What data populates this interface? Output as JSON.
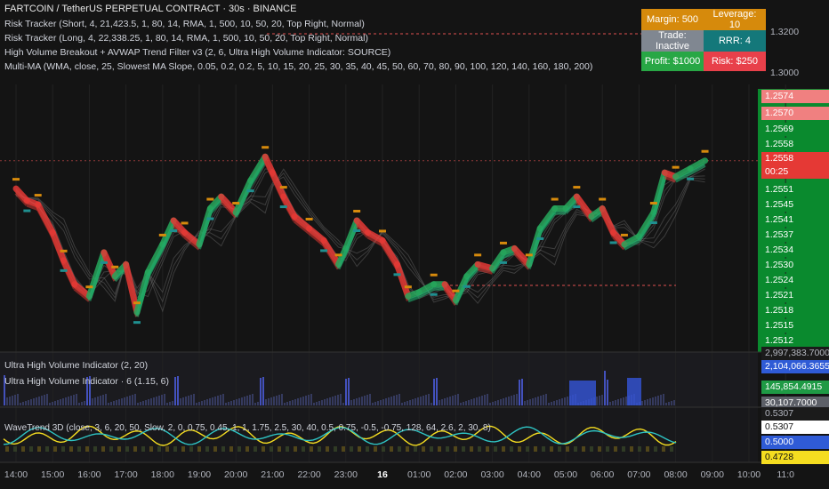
{
  "symbol_title": "FARTCOIN / TetherUS PERPETUAL CONTRACT · 30s · BINANCE",
  "indicators": [
    "Risk Tracker (Short, 4, 21,423.5, 1, 80, 14, RMA, 1, 500, 10, 50, 20, Top Right, Normal)",
    "Risk Tracker (Long, 4, 22,338.25, 1, 80, 14, RMA, 1, 500, 10, 50, 20, Top Right, Normal)",
    "High Volume Breakout + AVWAP Trend Filter v3 (2, 6, Ultra High Volume Indicator: SOURCE)",
    "Multi-MA (WMA, close, 25, Slowest MA Slope, 0.05, 0.2, 0.2, 5, 10, 15, 20, 25, 30, 35, 40, 45, 50, 60, 70, 80, 90, 100, 120, 140, 160, 180, 200)"
  ],
  "risk_table": {
    "margin": "Margin: 500",
    "leverage": "Leverage: 10",
    "trade": "Trade: Inactive",
    "rrr": "RRR: 4",
    "profit": "Profit: $1000",
    "risk": "Risk: $250"
  },
  "price_axis": {
    "ticks_upper": [
      "1.3200",
      "1.3000"
    ],
    "ticks": [
      "1.2569",
      "1.2558",
      "1.2551",
      "1.2545",
      "1.2541",
      "1.2537",
      "1.2534",
      "1.2530",
      "1.2524",
      "1.2521",
      "1.2518",
      "1.2515",
      "1.2512"
    ],
    "tag_red_1": "1.2574",
    "tag_red_2": "1.2570",
    "last_price": "1.2558",
    "countdown": "00:25"
  },
  "volume_pane": {
    "label1": "Ultra High Volume Indicator (2, 20)",
    "label2": "Ultra High Volume Indicator · 6 (1.15, 6)",
    "val_top": "2,997,383.7000",
    "val_blue": "2,104,066.3655",
    "val_green": "145,854.4915",
    "val_gray": "30,107.7000"
  },
  "wavetrend_pane": {
    "label": "WaveTrend 3D (close, 3, 6, 20, 50, Slow, 2, 0, 0.75, 0.45, 1, 1, 1.75, 2.5, 30, 40, 0.5, 0.75, -0.5, -0.75, 128, 64, 2.6, 2, 30, 8)",
    "v1": "0.5307",
    "v2": "0.5307",
    "v3": "0.5000",
    "v4": "0.4728"
  },
  "time_axis": [
    "14:00",
    "15:00",
    "16:00",
    "17:00",
    "18:00",
    "19:00",
    "20:00",
    "21:00",
    "22:00",
    "23:00",
    "16",
    "01:00",
    "02:00",
    "03:00",
    "04:00",
    "05:00",
    "06:00",
    "07:00",
    "08:00",
    "09:00",
    "10:00",
    "11:0"
  ],
  "colors": {
    "bg": "#141414",
    "up": "#26a65b",
    "down": "#e53935",
    "orange": "#d68a0c",
    "teal": "#1f8f8f",
    "blue_area": "#3455d8"
  },
  "chart_data": {
    "type": "line",
    "title": "FARTCOIN / TetherUS PERPETUAL CONTRACT · 30s · BINANCE",
    "x": [
      "14:00",
      "15:00",
      "16:00",
      "17:00",
      "18:00",
      "19:00",
      "20:00",
      "21:00",
      "22:00",
      "23:00",
      "16",
      "01:00",
      "02:00",
      "03:00",
      "04:00",
      "05:00",
      "06:00",
      "07:00",
      "08:00",
      "09:00"
    ],
    "y_range": [
      1.251,
      1.2576
    ],
    "series": [
      {
        "x": [
          0,
          0.3,
          0.6,
          1,
          1.3,
          1.6,
          2,
          2.4,
          2.7,
          3,
          3.3,
          3.6,
          4,
          4.3,
          4.6,
          5,
          5.3,
          5.6,
          6,
          6.4,
          6.8,
          7,
          7.3,
          7.6,
          8,
          8.4,
          8.8,
          9,
          9.3,
          9.6,
          10,
          10.4,
          10.7,
          11,
          11.4,
          11.7,
          12,
          12.3,
          12.6,
          13,
          13.3,
          13.6,
          14,
          14.3,
          14.7,
          15,
          15.3,
          15.7,
          16,
          16.3,
          16.6,
          17,
          17.4,
          17.7,
          18,
          18.4,
          18.8
        ],
        "y": [
          1.2551,
          1.2548,
          1.2547,
          1.254,
          1.2533,
          1.2527,
          1.2524,
          1.2535,
          1.2529,
          1.2532,
          1.252,
          1.253,
          1.2537,
          1.2543,
          1.254,
          1.2537,
          1.2546,
          1.2549,
          1.2545,
          1.2553,
          1.2559,
          1.2555,
          1.2549,
          1.2544,
          1.2541,
          1.2538,
          1.2532,
          1.2536,
          1.2543,
          1.254,
          1.2538,
          1.2532,
          1.2524,
          1.2525,
          1.2527,
          1.2527,
          1.2523,
          1.2529,
          1.2532,
          1.2531,
          1.2535,
          1.2536,
          1.2532,
          1.2541,
          1.2546,
          1.2546,
          1.2549,
          1.2544,
          1.2546,
          1.254,
          1.2537,
          1.2539,
          1.2545,
          1.2555,
          1.2554,
          1.2556,
          1.2558
        ]
      }
    ]
  }
}
